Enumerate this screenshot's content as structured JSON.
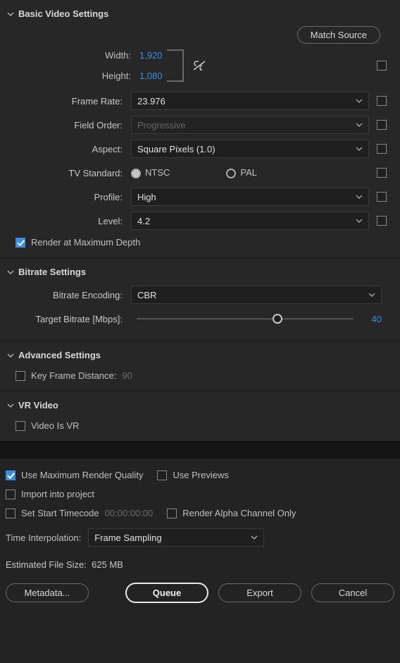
{
  "sections": {
    "basic": {
      "title": "Basic Video Settings",
      "match_source": "Match Source",
      "width_label": "Width:",
      "width_value": "1,920",
      "height_label": "Height:",
      "height_value": "1,080",
      "frame_rate_label": "Frame Rate:",
      "frame_rate_value": "23.976",
      "field_order_label": "Field Order:",
      "field_order_value": "Progressive",
      "aspect_label": "Aspect:",
      "aspect_value": "Square Pixels (1.0)",
      "tv_standard_label": "TV Standard:",
      "tv_ntsc": "NTSC",
      "tv_pal": "PAL",
      "profile_label": "Profile:",
      "profile_value": "High",
      "level_label": "Level:",
      "level_value": "4.2",
      "render_max_depth": "Render at Maximum Depth"
    },
    "bitrate": {
      "title": "Bitrate Settings",
      "encoding_label": "Bitrate Encoding:",
      "encoding_value": "CBR",
      "target_label": "Target Bitrate [Mbps]:",
      "target_value": "40"
    },
    "advanced": {
      "title": "Advanced Settings",
      "keyframe_label": "Key Frame Distance:",
      "keyframe_value": "90"
    },
    "vr": {
      "title": "VR Video",
      "video_is_vr": "Video Is VR"
    }
  },
  "footer": {
    "use_max_quality": "Use Maximum Render Quality",
    "use_previews": "Use Previews",
    "import_project": "Import into project",
    "set_start_tc": "Set Start Timecode",
    "tc_value": "00:00:00:00",
    "render_alpha": "Render Alpha Channel Only",
    "time_interp_label": "Time Interpolation:",
    "time_interp_value": "Frame Sampling",
    "est_label": "Estimated File Size:",
    "est_value": "625 MB",
    "metadata": "Metadata...",
    "queue": "Queue",
    "export": "Export",
    "cancel": "Cancel"
  }
}
